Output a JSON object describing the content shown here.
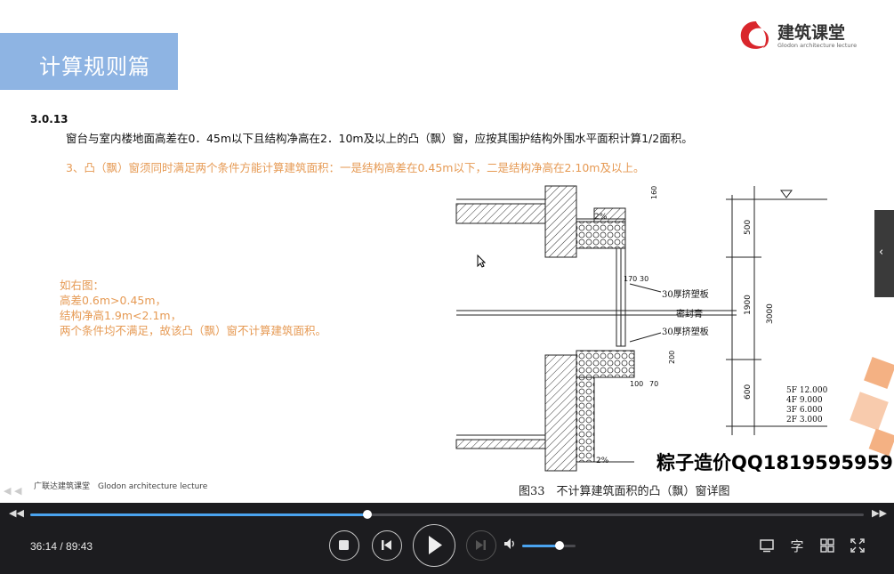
{
  "slide": {
    "title": "计算规则篇",
    "logo_main": "建筑课堂",
    "logo_sub": "Glodon architecture lecture",
    "rule_number": "3.0.13",
    "rule_text": "窗台与室内楼地面高差在0．45m以下且结构净高在2．10m及以上的凸（飘）窗，应按其围护结构外围水平面积计算1/2面积。",
    "note": "3、凸（飘）窗须同时满足两个条件方能计算建筑面积：一是结构高差在0.45m以下，二是结构净高在2.10m及以上。",
    "example_lines": [
      "如右图：",
      "高差0.6m>0.45m，",
      "结构净高1.9m<2.1m，",
      "两个条件均不满足，故该凸（飘）窗不计算建筑面积。"
    ],
    "drawing": {
      "caption": "图33　不计算建筑面积的凸（飘）窗详图",
      "labels": {
        "xps1": "30厚挤塑板",
        "seal": "密封膏",
        "xps2": "30厚挤塑板",
        "slope_top": "2%",
        "slope_bottom": "2%",
        "dim_500": "500",
        "dim_1900": "1900",
        "dim_3000": "3000",
        "dim_600": "600",
        "dim_170": "170",
        "dim_30": "30",
        "dim_200": "200",
        "dim_160a": "160",
        "dim_100": "100",
        "dim_70": "70"
      },
      "floors": [
        "5F  12.000",
        "4F   9.000",
        "3F   6.000",
        "2F   3.000"
      ]
    },
    "watermark": "粽子造价QQ1819595959",
    "footer": "广联达建筑课堂　Glodon  architecture  lecture"
  },
  "player": {
    "current_time": "36:14",
    "separator": " / ",
    "total_time": "89:43",
    "progress_fraction": 0.404,
    "volume_fraction": 0.7,
    "skip_back_icon": "◀◀",
    "skip_fwd_icon": "▶▶",
    "subtitle_label": "字",
    "accent_color": "#4aa3ef"
  }
}
